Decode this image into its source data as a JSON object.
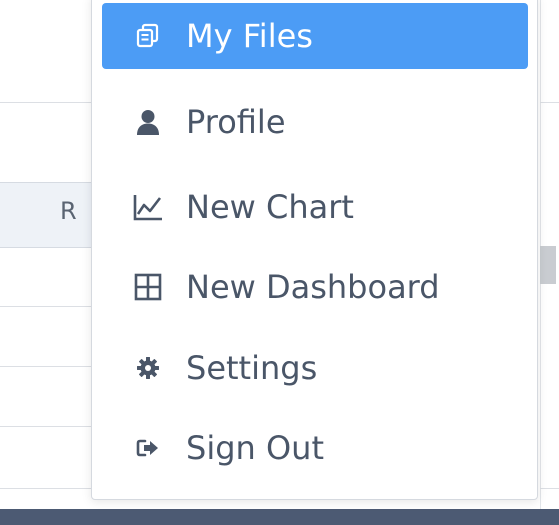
{
  "menu": {
    "items": [
      {
        "label": "My Files",
        "icon": "files-icon",
        "active": true
      },
      {
        "label": "Profile",
        "icon": "user-icon",
        "active": false
      },
      {
        "label": "New Chart",
        "icon": "line-chart-icon",
        "active": false
      },
      {
        "label": "New Dashboard",
        "icon": "grid-icon",
        "active": false
      },
      {
        "label": "Settings",
        "icon": "gear-icon",
        "active": false
      },
      {
        "label": "Sign Out",
        "icon": "sign-out-icon",
        "active": false
      }
    ]
  },
  "background_table": {
    "header_cell": "R"
  },
  "colors": {
    "active_bg": "#4c9cf5",
    "text": "#4a5668",
    "bottom_bar": "#4c5a73"
  }
}
